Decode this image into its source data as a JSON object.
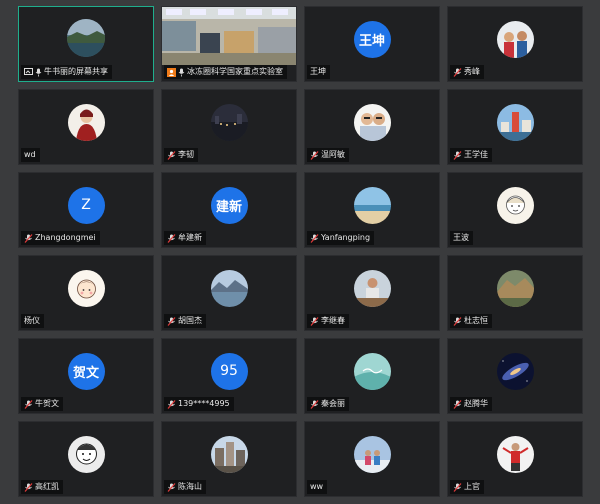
{
  "participants": [
    {
      "name": "牛书丽的屏幕共享",
      "kind": "screen",
      "icons": [
        "screen-share-icon",
        "mic-icon"
      ]
    },
    {
      "name": "冰冻圈科学国家重点实验室",
      "kind": "video",
      "icons": [
        "user-badge-icon",
        "mic-icon"
      ]
    },
    {
      "name": "王坤",
      "avatar_text": "王坤",
      "kind": "text",
      "icons": []
    },
    {
      "name": "秀峰",
      "kind": "photo",
      "icons": [
        "mic-muted-icon"
      ]
    },
    {
      "name": "wd",
      "kind": "photo",
      "icons": []
    },
    {
      "name": "李韧",
      "kind": "photo",
      "icons": [
        "mic-muted-icon"
      ]
    },
    {
      "name": "温阿敏",
      "kind": "photo",
      "icons": [
        "mic-muted-icon"
      ]
    },
    {
      "name": "王学佳",
      "kind": "photo",
      "icons": [
        "mic-muted-icon"
      ]
    },
    {
      "name": "Zhangdongmei",
      "avatar_text": "Z",
      "kind": "text",
      "icons": [
        "mic-muted-icon"
      ]
    },
    {
      "name": "牟建新",
      "avatar_text": "建新",
      "kind": "text",
      "icons": [
        "mic-muted-icon"
      ]
    },
    {
      "name": "Yanfangping",
      "kind": "photo",
      "icons": [
        "mic-muted-icon"
      ]
    },
    {
      "name": "王波",
      "kind": "photo",
      "icons": []
    },
    {
      "name": "杨仪",
      "kind": "photo",
      "icons": []
    },
    {
      "name": "胡国杰",
      "kind": "photo",
      "icons": [
        "mic-muted-icon"
      ]
    },
    {
      "name": "李继春",
      "kind": "photo",
      "icons": [
        "mic-muted-icon"
      ]
    },
    {
      "name": "杜志恒",
      "kind": "photo",
      "icons": [
        "mic-muted-icon"
      ]
    },
    {
      "name": "牛贺文",
      "avatar_text": "贺文",
      "kind": "text",
      "icons": [
        "mic-muted-icon"
      ]
    },
    {
      "name": "139****4995",
      "avatar_text": "95",
      "kind": "text",
      "icons": [
        "mic-muted-icon"
      ]
    },
    {
      "name": "秦会丽",
      "kind": "photo",
      "icons": [
        "mic-muted-icon"
      ]
    },
    {
      "name": "赵腾华",
      "kind": "photo",
      "icons": [
        "mic-muted-icon"
      ]
    },
    {
      "name": "高红凯",
      "kind": "photo",
      "icons": [
        "mic-muted-icon"
      ]
    },
    {
      "name": "陈海山",
      "kind": "photo",
      "icons": [
        "mic-muted-icon"
      ]
    },
    {
      "name": "ww",
      "kind": "photo",
      "icons": []
    },
    {
      "name": "上官",
      "kind": "photo",
      "icons": [
        "mic-muted-icon"
      ]
    }
  ],
  "colors": {
    "avatar_blue": "#1e73e8",
    "active_border": "#1fae8d",
    "tile_bg": "#1f2022",
    "page_bg": "#3a3b3d"
  }
}
